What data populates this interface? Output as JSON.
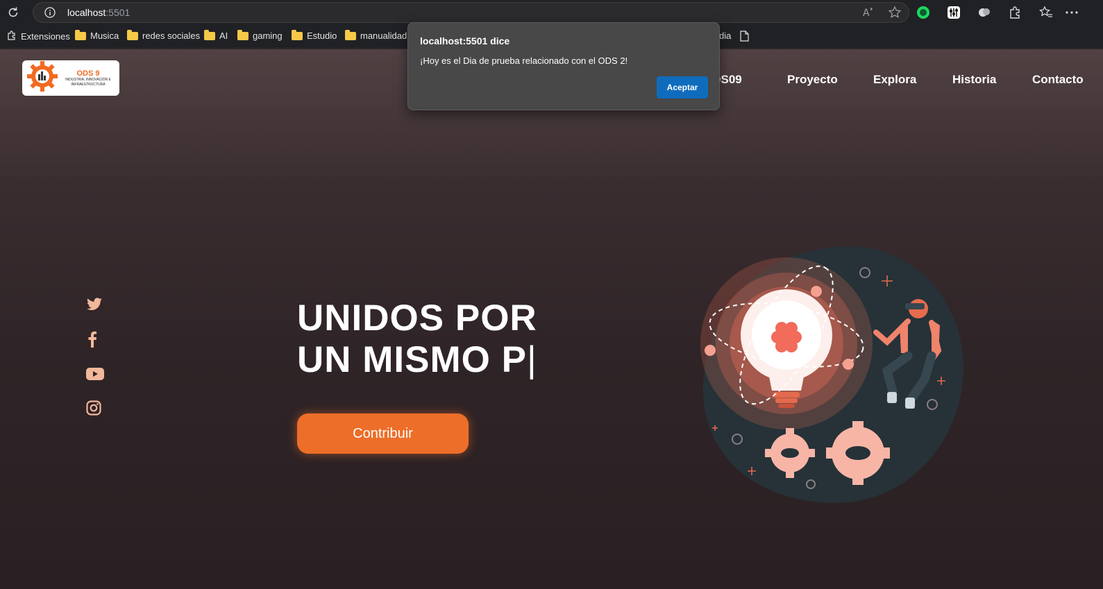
{
  "browser": {
    "url_host": "localhost",
    "url_port": ":5501",
    "bookmarks": [
      {
        "label": "Extensiones"
      },
      {
        "label": "Musica"
      },
      {
        "label": "redes sociales"
      },
      {
        "label": "AI"
      },
      {
        "label": "gaming"
      },
      {
        "label": "Estudio"
      },
      {
        "label": "manualidad"
      },
      {
        "label": "media"
      }
    ]
  },
  "site": {
    "logo": {
      "title": "ODS 9",
      "subtitle_1": "INDUSTRIA, INNOVACIÓN E",
      "subtitle_2": "INFRAESTRUCTURA"
    },
    "nav": [
      "ODS09",
      "Proyecto",
      "Explora",
      "Historia",
      "Contacto"
    ],
    "social": [
      "twitter-icon",
      "facebook-icon",
      "youtube-icon",
      "instagram-icon"
    ],
    "hero": {
      "line1": "UNIDOS POR",
      "line2": "UN MISMO P",
      "cursor": "|"
    },
    "cta_label": "Contribuir",
    "accent": "#ed6e28"
  },
  "dialog": {
    "title": "localhost:5501 dice",
    "message": "¡Hoy es el Dia de prueba relacionado con el ODS 2!",
    "ok_label": "Aceptar"
  }
}
